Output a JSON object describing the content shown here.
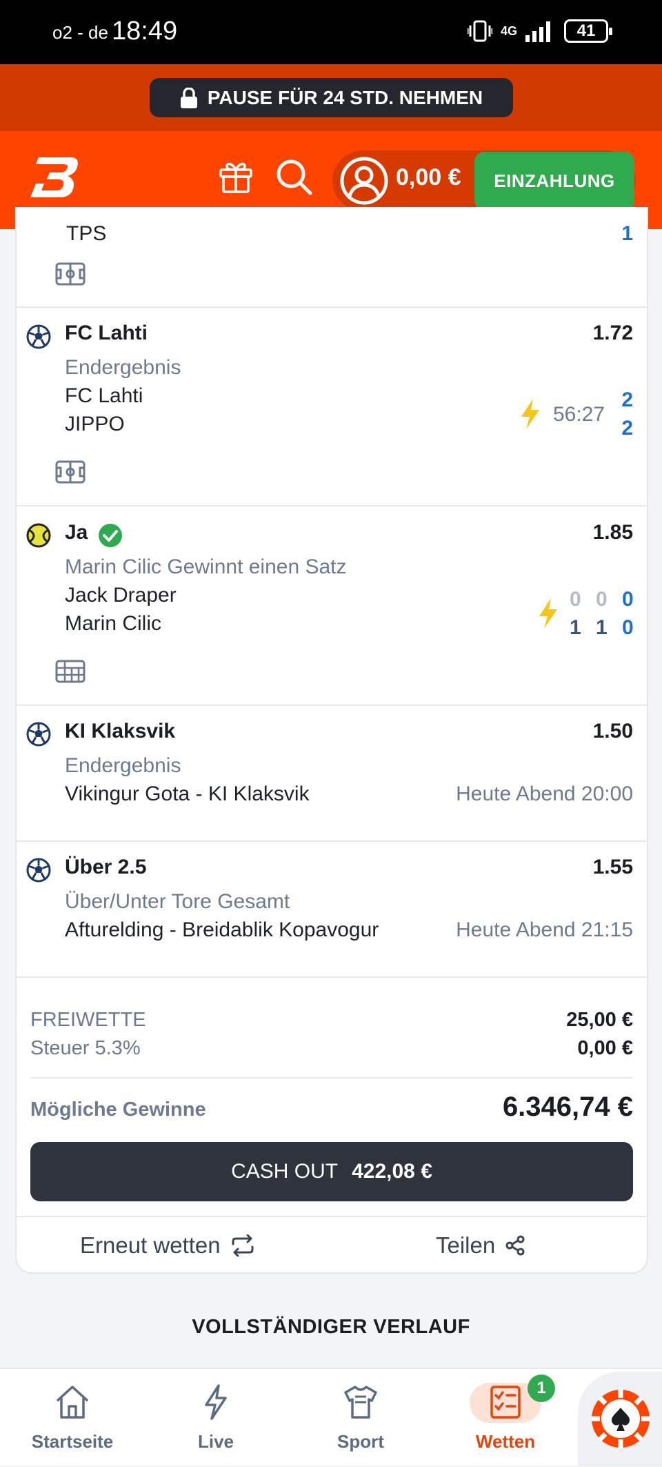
{
  "status_bar": {
    "carrier": "o2 - de",
    "time": "18:49",
    "network": "4G",
    "battery": "41"
  },
  "pause_banner": {
    "label": "PAUSE FÜR 24 STD. NEHMEN"
  },
  "header": {
    "balance": "0,00 €",
    "deposit_label": "EINZAHLUNG"
  },
  "bets": [
    {
      "cut_title": "TPS",
      "cut_score": "1"
    },
    {
      "title": "FC Lahti",
      "odds": "1.72",
      "market": "Endergebnis",
      "team1": "FC Lahti",
      "team2": "JIPPO",
      "time": "56:27",
      "score1": "2",
      "score2": "2",
      "sport": "football"
    },
    {
      "title": "Ja",
      "odds": "1.85",
      "market": "Marin Cilic Gewinnt einen Satz",
      "team1": "Jack Draper",
      "team2": "Marin Cilic",
      "sets1": [
        "0",
        "0",
        "0"
      ],
      "sets2": [
        "1",
        "1",
        "0"
      ],
      "sport": "tennis",
      "won": true
    },
    {
      "title": "KI Klaksvik",
      "odds": "1.50",
      "market": "Endergebnis",
      "match": "Vikingur Gota - KI Klaksvik",
      "kickoff": "Heute Abend 20:00",
      "sport": "football"
    },
    {
      "title": "Über 2.5",
      "odds": "1.55",
      "market": "Über/Unter Tore Gesamt",
      "match": "Afturelding - Breidablik Kopavogur",
      "kickoff": "Heute Abend 21:15",
      "sport": "football"
    }
  ],
  "summary": {
    "freebet_label": "FREIWETTE",
    "freebet_value": "25,00 €",
    "tax_label": "Steuer 5.3%",
    "tax_value": "0,00 €",
    "winnings_label": "Mögliche Gewinne",
    "winnings_value": "6.346,74 €",
    "cashout_label": "CASH OUT",
    "cashout_value": "422,08 €"
  },
  "actions": {
    "rebet": "Erneut wetten",
    "share": "Teilen"
  },
  "history_link": "VOLLSTÄNDIGER VERLAUF",
  "nav": {
    "items": [
      {
        "label": "Startseite"
      },
      {
        "label": "Live"
      },
      {
        "label": "Sport"
      },
      {
        "label": "Wetten",
        "badge": "1"
      }
    ]
  },
  "colors": {
    "brand": "#ff4400",
    "brand_dark": "#d03a00",
    "deposit": "#2faa4f",
    "odds_blue": "#1f6fd0",
    "dark": "#2e333d"
  }
}
